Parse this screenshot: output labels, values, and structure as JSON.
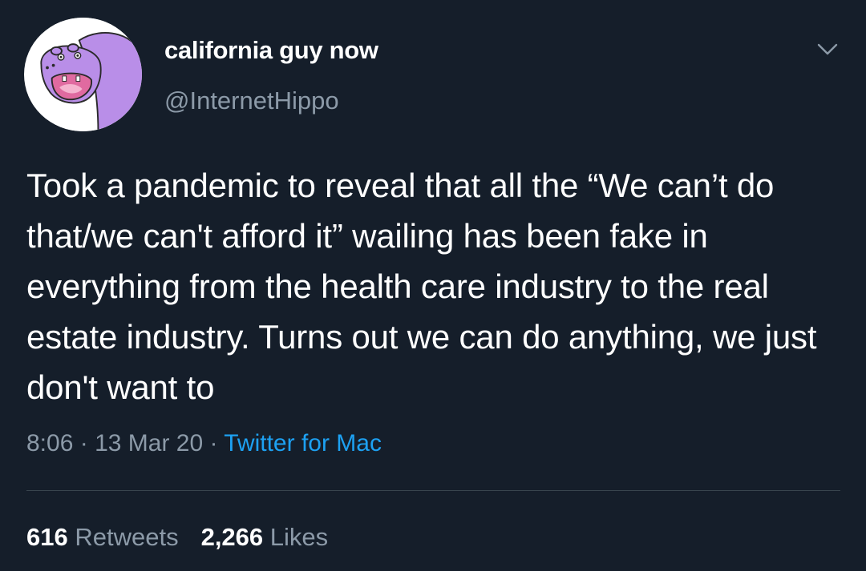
{
  "tweet": {
    "author": {
      "display_name": "california guy now",
      "handle": "@InternetHippo",
      "avatar_icon": "hippo-avatar-icon"
    },
    "text": "Took a pandemic to reveal that all the “We can’t do that/we can't afford it” wailing has been fake in everything from the health care industry to the real estate industry. Turns out we can do anything, we just don't want to",
    "meta": {
      "time": "8:06",
      "separator": " · ",
      "date": "13 Mar 20",
      "source": "Twitter for Mac"
    },
    "stats": {
      "retweets_count": "616",
      "retweets_label": " Retweets",
      "likes_count": "2,266",
      "likes_label": " Likes"
    },
    "menu_icon": "chevron-down-icon"
  },
  "colors": {
    "background": "#151e2a",
    "text_primary": "#ffffff",
    "text_secondary": "#8c9aa8",
    "link": "#1da1f2",
    "divider": "#38444d",
    "avatar_hippo": "#b98ee8"
  }
}
